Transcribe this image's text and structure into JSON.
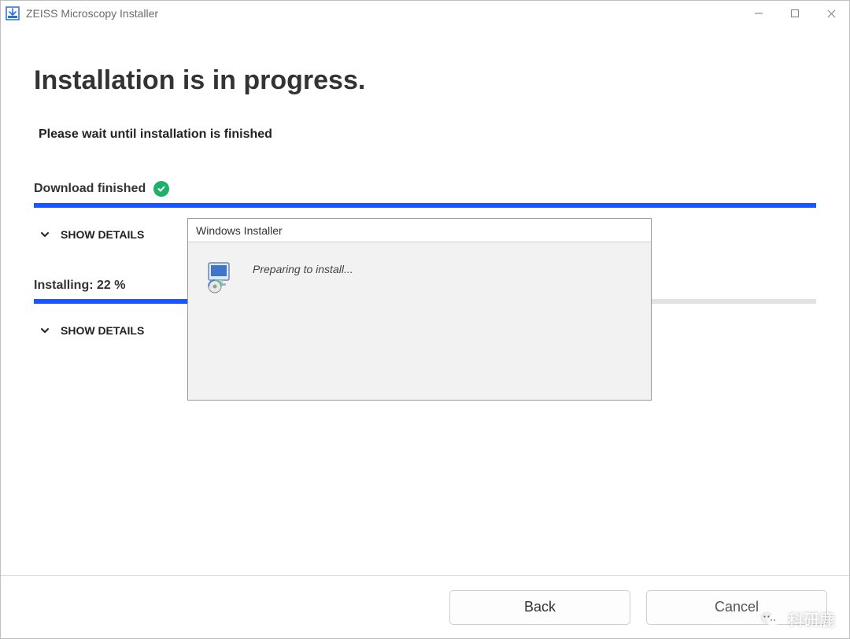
{
  "titlebar": {
    "title": "ZEISS Microscopy Installer"
  },
  "main": {
    "heading": "Installation is in progress.",
    "wait_text": "Please wait until installation is finished",
    "download": {
      "label": "Download finished",
      "progress_percent": 100,
      "details_toggle": "SHOW DETAILS"
    },
    "install": {
      "label": "Installing: 22 %",
      "progress_percent": 22,
      "details_toggle": "SHOW DETAILS"
    }
  },
  "dialog": {
    "title": "Windows Installer",
    "message": "Preparing to install..."
  },
  "footer": {
    "back_label": "Back",
    "cancel_label": "Cancel"
  },
  "watermark": {
    "text": "科研鹿"
  }
}
